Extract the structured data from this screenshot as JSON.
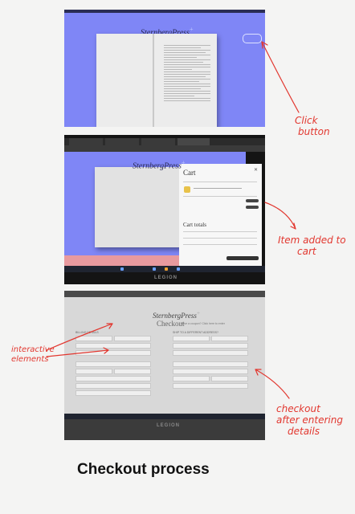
{
  "caption": "Checkout process",
  "annotations": {
    "click_button": [
      "Click",
      "button"
    ],
    "item_added": [
      "Item added to",
      "cart"
    ],
    "interactive": [
      "interactive",
      "elements"
    ],
    "checkout_after": [
      "checkout",
      "after entering",
      "details"
    ]
  },
  "photo1": {
    "logo": "SternbergPress",
    "logo_mark": "+"
  },
  "photo2": {
    "logo": "SternbergPress",
    "logo_mark": "+",
    "cart_title": "Cart",
    "cart_totals": "Cart totals",
    "brand": "LEGION"
  },
  "photo3": {
    "logo": "SternbergPress",
    "logo_mark": "+",
    "checkout_title": "Checkout",
    "coupon_prompt": "Have a coupon? Click here to enter",
    "billing": "BILLING DETAILS",
    "shipping": "SHIP TO A DIFFERENT ADDRESS?",
    "brand": "LEGION"
  },
  "colors": {
    "annotation": "#e2372f",
    "site_background": "#7f86f6"
  }
}
